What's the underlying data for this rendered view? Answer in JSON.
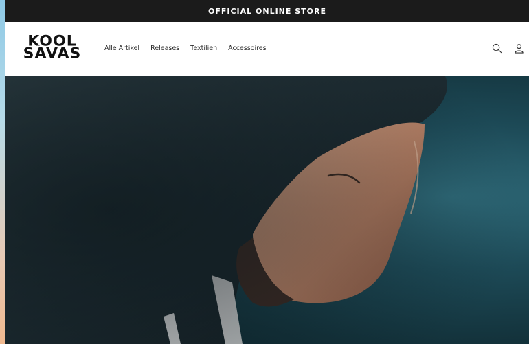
{
  "announcement": {
    "text": "OFFICIAL ONLINE STORE"
  },
  "brand": {
    "line1": "KOOL",
    "line2": "SAVAS"
  },
  "nav": {
    "items": [
      {
        "label": "Alle Artikel"
      },
      {
        "label": "Releases"
      },
      {
        "label": "Textilien"
      },
      {
        "label": "Accessoires"
      }
    ]
  },
  "header_icons": [
    "search-icon",
    "account-icon"
  ],
  "colors": {
    "announcement_bg": "#1b1b1b",
    "header_bg": "#ffffff",
    "hero_bg": "#1d4a57"
  }
}
